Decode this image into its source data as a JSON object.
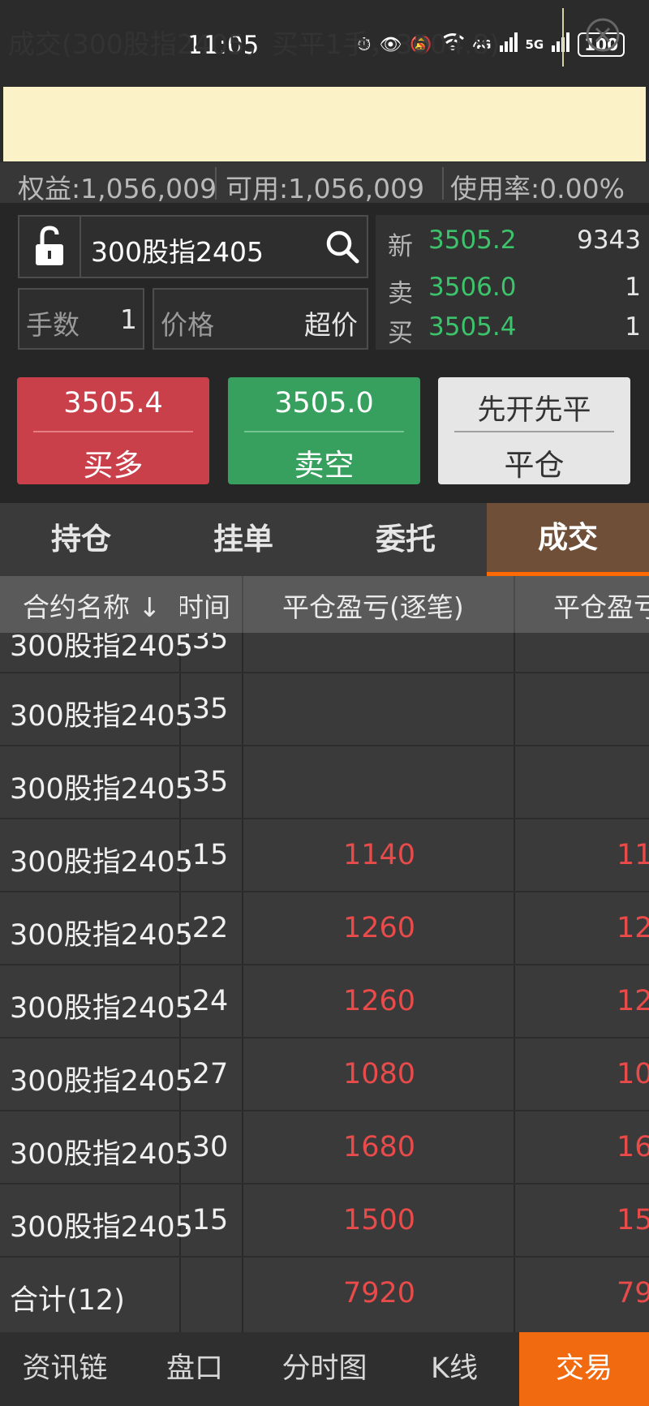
{
  "status_bar": {
    "time": "11:05",
    "battery": "100",
    "network_1": "4G",
    "network_2": "5G"
  },
  "banner": {
    "text": "成交(300股指2405，买平1手，3504.8)"
  },
  "account": {
    "equity": "权益:1,056,009",
    "available": "可用:1,056,009",
    "usage": "使用率:0.00%"
  },
  "order": {
    "symbol": "300股指2405",
    "lots_label": "手数",
    "lots_value": "1",
    "price_label": "价格",
    "price_value": "超价"
  },
  "quote": {
    "last_label": "新",
    "last_price": "3505.2",
    "last_volume": "9343",
    "ask_label": "卖",
    "ask_price": "3506.0",
    "ask_volume": "1",
    "bid_label": "买",
    "bid_price": "3505.4",
    "bid_volume": "1"
  },
  "buttons": {
    "buy_price": "3505.4",
    "buy_label": "买多",
    "sell_price": "3505.0",
    "sell_label": "卖空",
    "close_mode": "先开先平",
    "close_label": "平仓"
  },
  "tabs": [
    "持仓",
    "挂单",
    "委托",
    "成交"
  ],
  "table": {
    "headers": {
      "name": "合约名称 ↓",
      "time": "时间",
      "pl_each": "平仓盈亏(逐笔)",
      "pl_daily": "平仓盈亏"
    },
    "rows": [
      {
        "name": "300股指2405",
        "time": ":35",
        "pl": "",
        "pl2": ""
      },
      {
        "name": "300股指2405",
        "time": ":35",
        "pl": "",
        "pl2": ""
      },
      {
        "name": "300股指2405",
        "time": ":35",
        "pl": "",
        "pl2": ""
      },
      {
        "name": "300股指2405",
        "time": ":15",
        "pl": "1140",
        "pl2": "11"
      },
      {
        "name": "300股指2405",
        "time": ":22",
        "pl": "1260",
        "pl2": "12"
      },
      {
        "name": "300股指2405",
        "time": ":24",
        "pl": "1260",
        "pl2": "12"
      },
      {
        "name": "300股指2405",
        "time": ":27",
        "pl": "1080",
        "pl2": "10"
      },
      {
        "name": "300股指2405",
        "time": ":30",
        "pl": "1680",
        "pl2": "16"
      },
      {
        "name": "300股指2405",
        "time": ":15",
        "pl": "1500",
        "pl2": "15"
      }
    ],
    "total": {
      "name": "合计(12)",
      "pl": "7920",
      "pl2": "79"
    }
  },
  "bottom_nav": [
    "资讯链",
    "盘口",
    "分时图",
    "K线",
    "交易"
  ]
}
